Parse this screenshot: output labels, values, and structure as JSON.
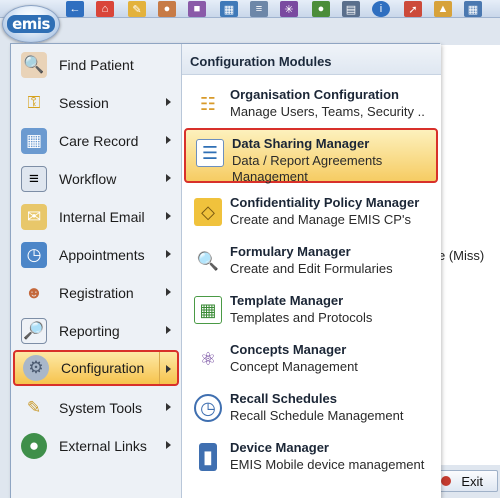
{
  "app": {
    "logo_text": "emis"
  },
  "toolbar_icons": [
    "back-arrow-icon",
    "home-icon",
    "pencil-icon",
    "patients-icon",
    "notebook-icon",
    "calendar-icon",
    "document-icon",
    "atom-icon",
    "users-icon",
    "clipboard-icon",
    "info-icon",
    "wand-icon",
    "hierarchy-icon",
    "grid-icon"
  ],
  "background": {
    "partial_text": "e (Miss)",
    "exit_label": "Exit"
  },
  "main_menu": {
    "items": [
      {
        "label": "Find Patient",
        "icon": "find-patient-icon",
        "has_submenu": false
      },
      {
        "label": "Session",
        "icon": "key-icon",
        "has_submenu": true
      },
      {
        "label": "Care Record",
        "icon": "care-record-icon",
        "has_submenu": true
      },
      {
        "label": "Workflow",
        "icon": "workflow-icon",
        "has_submenu": true
      },
      {
        "label": "Internal Email",
        "icon": "email-icon",
        "has_submenu": true
      },
      {
        "label": "Appointments",
        "icon": "appointments-icon",
        "has_submenu": true
      },
      {
        "label": "Registration",
        "icon": "registration-icon",
        "has_submenu": true
      },
      {
        "label": "Reporting",
        "icon": "reporting-icon",
        "has_submenu": true
      },
      {
        "label": "Configuration",
        "icon": "configuration-icon",
        "has_submenu": true,
        "active": true
      },
      {
        "label": "System Tools",
        "icon": "system-tools-icon",
        "has_submenu": true
      },
      {
        "label": "External Links",
        "icon": "external-links-icon",
        "has_submenu": true
      }
    ]
  },
  "submenu": {
    "title": "Configuration Modules",
    "items": [
      {
        "title": "Organisation Configuration",
        "desc": "Manage Users, Teams, Security ..",
        "icon": "org-chart-icon"
      },
      {
        "title": "Data Sharing Manager",
        "desc": "Data / Report Agreements Management",
        "icon": "data-sharing-icon",
        "active": true
      },
      {
        "title": "Confidentiality Policy Manager",
        "desc": "Create and Manage EMIS CP's",
        "icon": "padlock-icon"
      },
      {
        "title": "Formulary Manager",
        "desc": "Create and Edit Formularies",
        "icon": "formulary-search-icon"
      },
      {
        "title": "Template Manager",
        "desc": "Templates and Protocols",
        "icon": "template-table-icon"
      },
      {
        "title": "Concepts Manager",
        "desc": "Concept Management",
        "icon": "atom-icon"
      },
      {
        "title": "Recall Schedules",
        "desc": "Recall Schedule Management",
        "icon": "clock-icon"
      },
      {
        "title": "Device Manager",
        "desc": "EMIS Mobile device management",
        "icon": "mobile-device-icon"
      }
    ]
  }
}
